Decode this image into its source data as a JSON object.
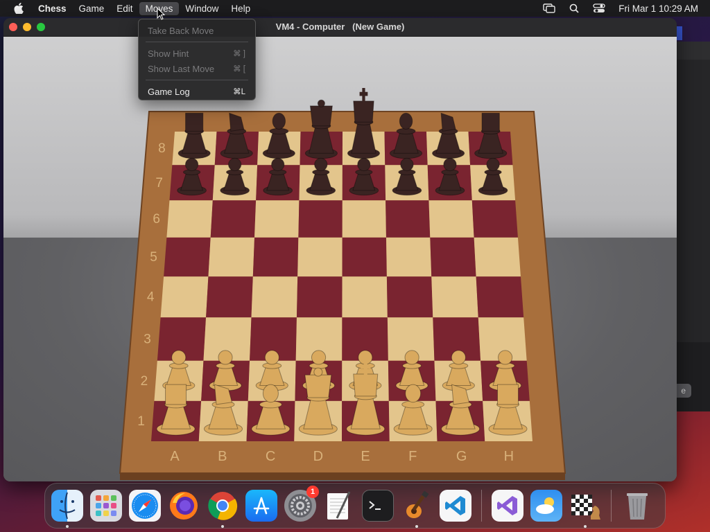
{
  "menubar": {
    "app_name": "Chess",
    "menus": [
      "Game",
      "Edit",
      "Moves",
      "Window",
      "Help"
    ],
    "open_menu": "Moves",
    "clock": "Fri Mar 1  10:29 AM",
    "status_icons": [
      "screen-mirroring-icon",
      "spotlight-search-icon",
      "control-center-icon"
    ]
  },
  "moves_menu": {
    "items": [
      {
        "label": "Take Back Move",
        "shortcut": "",
        "enabled": false
      },
      {
        "label": "Show Hint",
        "shortcut": "⌘ ]",
        "enabled": false
      },
      {
        "label": "Show Last Move",
        "shortcut": "⌘ [",
        "enabled": false
      },
      {
        "label": "Game Log",
        "shortcut": "⌘L",
        "enabled": true
      }
    ]
  },
  "window": {
    "title": "VM4 - Computer   (New Game)"
  },
  "board": {
    "files": [
      "A",
      "B",
      "C",
      "D",
      "E",
      "F",
      "G",
      "H"
    ],
    "ranks": [
      "8",
      "7",
      "6",
      "5",
      "4",
      "3",
      "2",
      "1"
    ],
    "light_square": "#e3c58c",
    "dark_square": "#7a2430",
    "frame_color": "#a86f3c",
    "white_piece": "#d9a95e",
    "black_piece": "#3a2422"
  },
  "background_window": {
    "button_label": "e"
  },
  "dock": {
    "apps": [
      {
        "name": "Finder",
        "icon": "finder-icon",
        "running": true
      },
      {
        "name": "Launchpad",
        "icon": "launchpad-icon",
        "running": false
      },
      {
        "name": "Safari",
        "icon": "safari-icon",
        "running": false
      },
      {
        "name": "Firefox",
        "icon": "firefox-icon",
        "running": false
      },
      {
        "name": "Chrome",
        "icon": "chrome-icon",
        "running": true
      },
      {
        "name": "App Store",
        "icon": "app-store-icon",
        "running": false
      },
      {
        "name": "System Settings",
        "icon": "system-settings-icon",
        "running": false,
        "badge": "1"
      },
      {
        "name": "TextEdit",
        "icon": "textedit-icon",
        "running": false
      },
      {
        "name": "Terminal",
        "icon": "terminal-icon",
        "running": false
      },
      {
        "name": "GarageBand",
        "icon": "garageband-icon",
        "running": true
      },
      {
        "name": "Visual Studio Code",
        "icon": "vscode-icon",
        "running": false
      }
    ],
    "recent_apps": [
      {
        "name": "Visual Studio",
        "icon": "visual-studio-icon",
        "running": false
      },
      {
        "name": "Weather",
        "icon": "weather-icon",
        "running": false
      },
      {
        "name": "Chess",
        "icon": "chess-icon",
        "running": true
      }
    ],
    "trash": {
      "name": "Trash",
      "icon": "trash-icon"
    }
  }
}
